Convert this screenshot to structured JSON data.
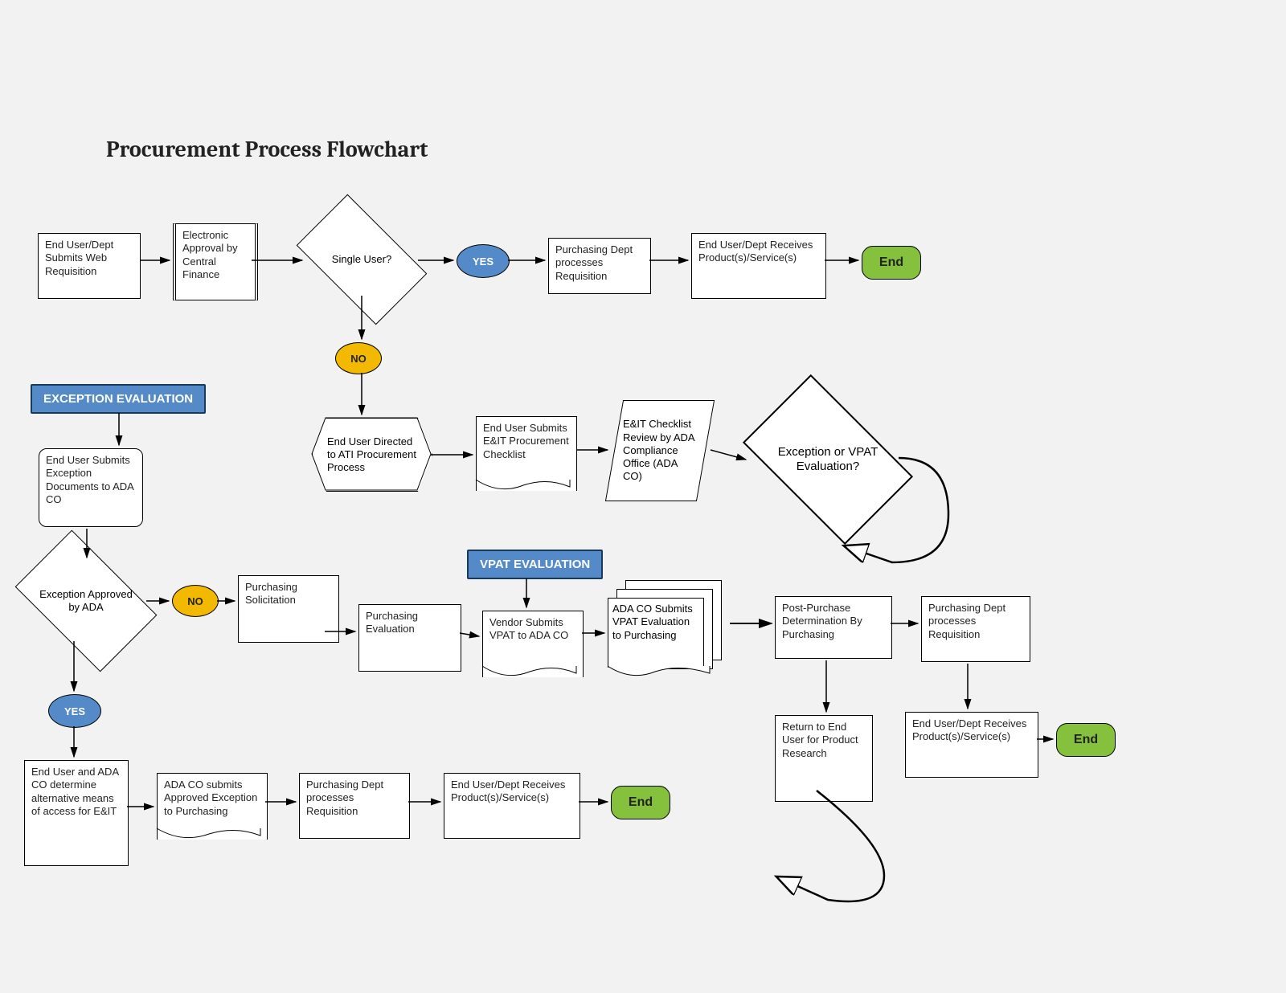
{
  "title": "Procurement Process Flowchart",
  "row1": {
    "submit": "End User/Dept Submits Web Requisition",
    "approval": "Electronic Approval by Central Finance",
    "single": "Single User?",
    "yes": "YES",
    "purch": "Purchasing Dept processes Requisition",
    "receive": "End User/Dept Receives Product(s)/Service(s)",
    "end": "End"
  },
  "row2": {
    "no": "NO",
    "ati": "End User Directed to ATI Procurement Process",
    "checklist": "End User Submits E&IT Procurement Checklist",
    "review": "E&IT Checklist Review by ADA Compliance Office (ADA CO)",
    "decision": "Exception or VPAT Evaluation?"
  },
  "exc": {
    "header": "EXCEPTION EVALUATION",
    "docs": "End User Submits Exception Documents to ADA CO",
    "approved": "Exception Approved by ADA",
    "no": "NO",
    "solicit": "Purchasing Solicitation",
    "yes": "YES",
    "altmeans": "End User and ADA CO determine alternative means of access for E&IT",
    "adasubmit": "ADA CO submits Approved Exception to Purchasing",
    "purch": "Purchasing Dept processes Requisition",
    "receive": "End User/Dept Receives Product(s)/Service(s)",
    "end": "End"
  },
  "vpat": {
    "header": "VPAT EVALUATION",
    "purch_eval": "Purchasing Evaluation",
    "vendor": "Vendor Submits VPAT to ADA CO",
    "adaco": "ADA CO Submits VPAT Evaluation to Purchasing",
    "post": "Post-Purchase Determination By Purchasing",
    "return": "Return to End User for Product Research",
    "preq": "Purchasing Dept processes Requisition",
    "receive": "End User/Dept Receives Product(s)/Service(s)",
    "end": "End"
  }
}
